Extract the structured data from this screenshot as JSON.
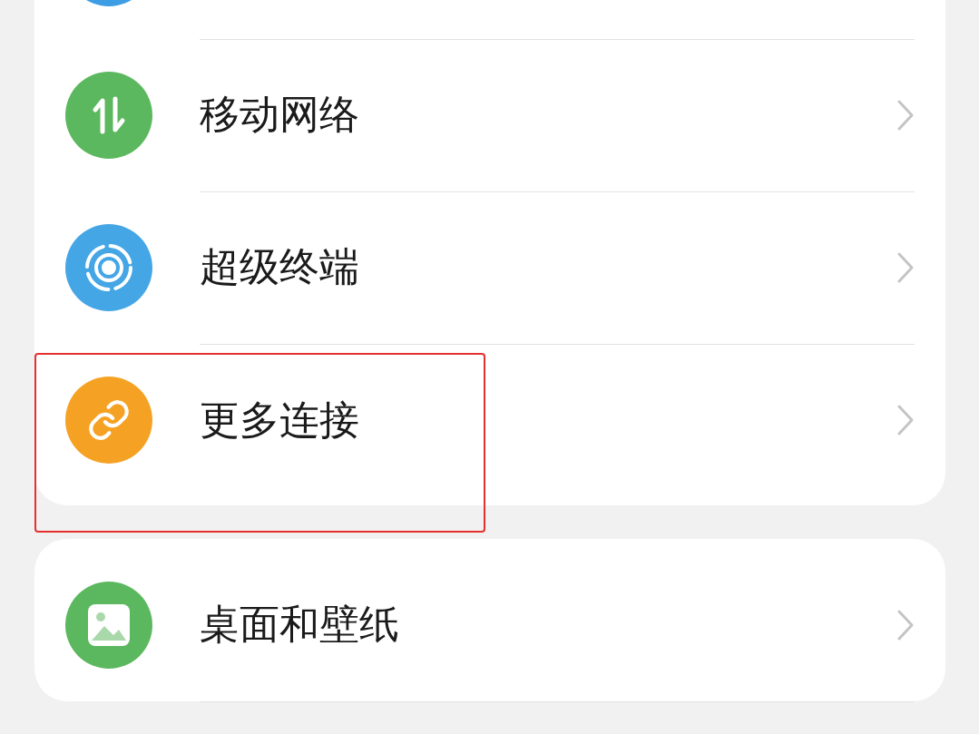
{
  "groups": [
    {
      "items": [
        {
          "kind": "partial",
          "color": "#3d9ee6"
        },
        {
          "kind": "arrows",
          "color": "#5cb85f",
          "label": "移动网络",
          "highlighted": false
        },
        {
          "kind": "rings",
          "color": "#45a6e6",
          "label": "超级终端",
          "highlighted": false
        },
        {
          "kind": "link",
          "color": "#f5a224",
          "label": "更多连接",
          "highlighted": true
        }
      ]
    },
    {
      "items": [
        {
          "kind": "image",
          "color": "#5cb85f",
          "label": "桌面和壁纸",
          "highlighted": false
        }
      ]
    }
  ]
}
